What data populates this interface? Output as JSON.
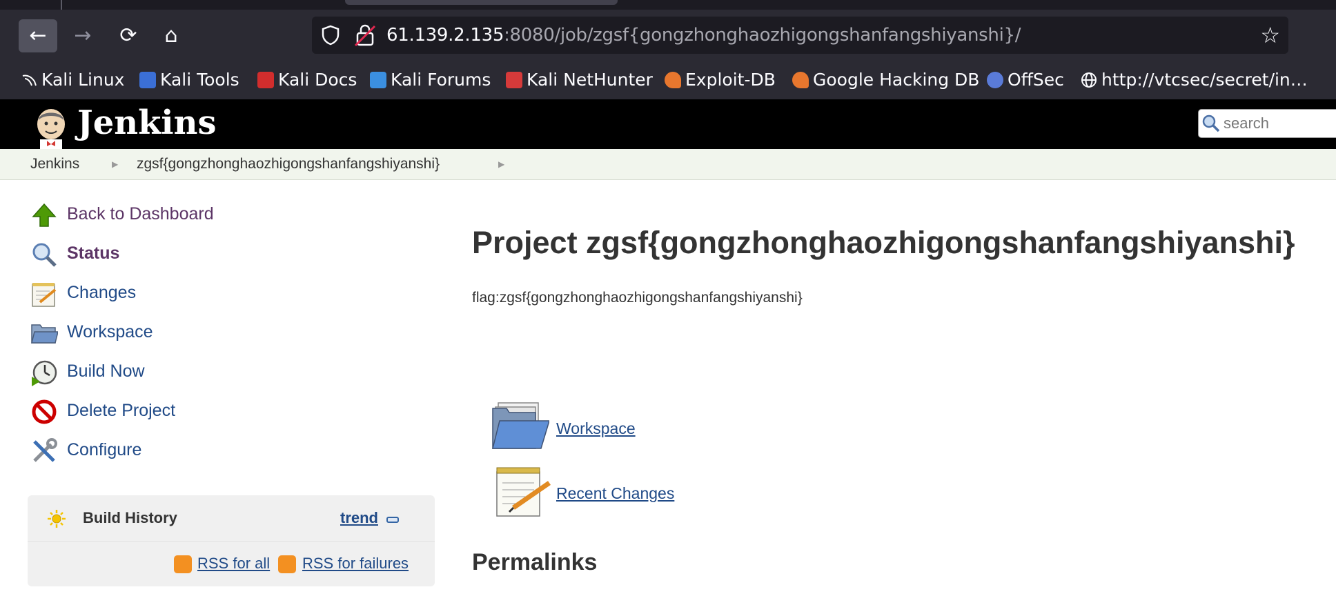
{
  "browser": {
    "url_host": "61.139.2.135",
    "url_rest": ":8080/job/zgsf{gongzhonghaozhigongshanfangshiyanshi}/",
    "bookmarks": [
      {
        "label": "Kali Linux",
        "color": "#2b2a33"
      },
      {
        "label": "Kali Tools",
        "color": "#3b6fd6"
      },
      {
        "label": "Kali Docs",
        "color": "#d22d2d"
      },
      {
        "label": "Kali Forums",
        "color": "#3b8fe0"
      },
      {
        "label": "Kali NetHunter",
        "color": "#d63a3a"
      },
      {
        "label": "Exploit-DB",
        "color": "#e8772e"
      },
      {
        "label": "Google Hacking DB",
        "color": "#e8772e"
      },
      {
        "label": "OffSec",
        "color": "#5a7bd8"
      },
      {
        "label": "http://vtcsec/secret/in…",
        "color": "#2b2a33"
      }
    ]
  },
  "jenkins": {
    "title": "Jenkins",
    "search_placeholder": "search"
  },
  "breadcrumb": [
    "Jenkins",
    "zgsf{gongzhonghaozhigongshanfangshiyanshi}"
  ],
  "sidebar": {
    "tasks": [
      {
        "label": "Back to Dashboard",
        "icon": "up-arrow-icon"
      },
      {
        "label": "Status",
        "icon": "magnifier-icon"
      },
      {
        "label": "Changes",
        "icon": "notepad-icon"
      },
      {
        "label": "Workspace",
        "icon": "folder-icon"
      },
      {
        "label": "Build Now",
        "icon": "clock-icon"
      },
      {
        "label": "Delete Project",
        "icon": "no-entry-icon"
      },
      {
        "label": "Configure",
        "icon": "tools-icon"
      }
    ],
    "build_history": {
      "title": "Build History",
      "trend": "trend",
      "rss_all": "RSS for all",
      "rss_failures": "RSS for failures"
    }
  },
  "main": {
    "title": "Project zgsf{gongzhonghaozhigongshanfangshiyanshi}",
    "description": "flag:zgsf{gongzhonghaozhigongshanfangshiyanshi}",
    "links": {
      "workspace": "Workspace",
      "recent_changes": "Recent Changes"
    },
    "permalinks_heading": "Permalinks"
  },
  "colors": {
    "link": "#204a87",
    "visited": "#5c3566",
    "header_bg": "#000000",
    "breadcrumb_bg": "#f1f5ed"
  }
}
